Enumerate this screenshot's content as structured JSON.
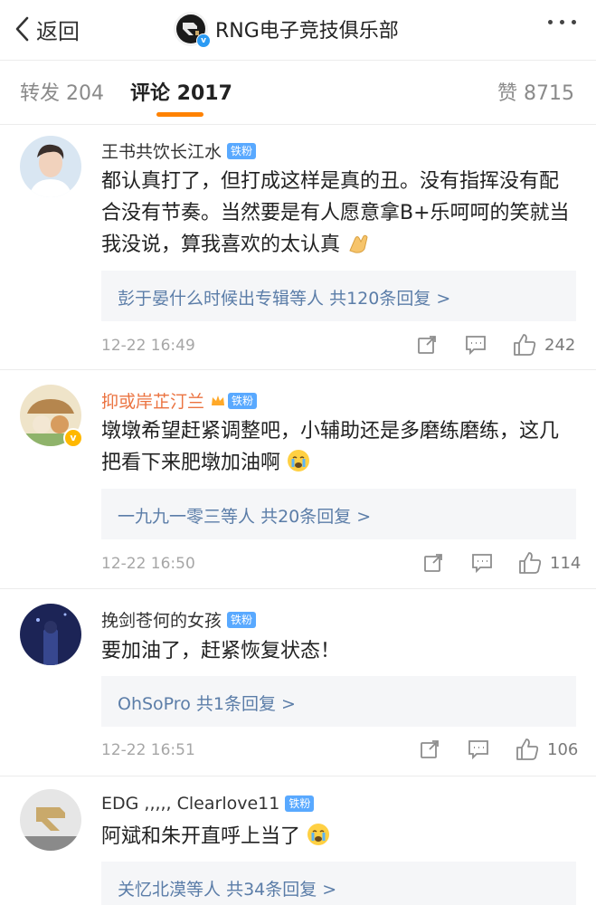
{
  "nav": {
    "back_label": "返回",
    "title": "RNG电子竞技俱乐部",
    "logo_icon": "rng-logo",
    "more_icon": "more-dots-icon"
  },
  "tabs": {
    "repost": "转发 204",
    "comment": "评论 2017",
    "like": "赞 8715",
    "active": "comment",
    "accent": "#ff8200"
  },
  "comments": [
    {
      "user": "王书共饮长江水",
      "badge": "铁粉",
      "text": "都认真打了，但打成这样是真的丑。没有指挥没有配合没有节奏。当然要是有人愿意拿B+乐呵呵的笑就当我没说，算我喜欢的太认真",
      "emoji": "clapping-hands",
      "replies_names": "彭于晏什么时候出专辑",
      "replies_mid": "等人",
      "replies_count": "共120条回复 >",
      "time": "12-22 16:49",
      "likes": "242"
    },
    {
      "user": "抑或岸芷汀兰",
      "badge": "铁粉",
      "text": "墩墩希望赶紧调整吧，小辅助还是多磨练磨练，这几把看下来肥墩加油啊",
      "emoji": "crying-face",
      "replies_names": "一九九一零三",
      "replies_mid": "等人",
      "replies_count": "共20条回复 >",
      "time": "12-22 16:50",
      "likes": "114"
    },
    {
      "user": "挽剑苍何的女孩",
      "badge": "铁粉",
      "text": "要加油了，赶紧恢复状态！",
      "replies_names": "OhSoPro",
      "replies_mid": "",
      "replies_count": "共1条回复 >",
      "time": "12-22 16:51",
      "likes": "106"
    },
    {
      "user": "EDG ,,,,, Clearlove11",
      "badge": "铁粉",
      "text": "阿斌和朱开直呼上当了",
      "emoji": "crying-face",
      "replies_names": "关忆北漠",
      "replies_mid": "等人",
      "replies_count": "共34条回复 >"
    }
  ]
}
